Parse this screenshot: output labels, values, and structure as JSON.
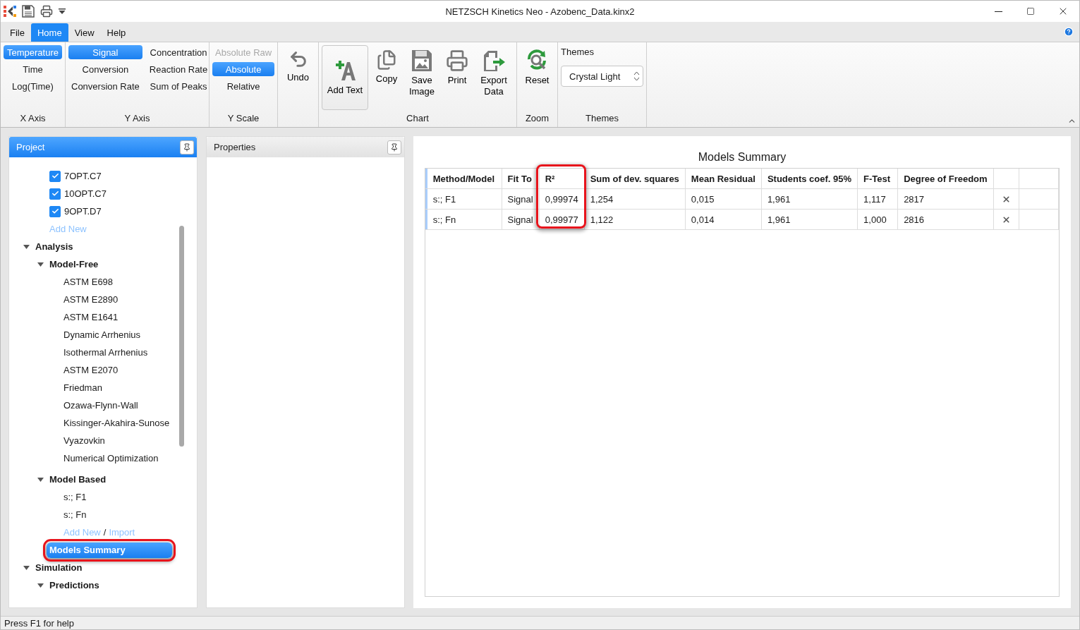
{
  "window": {
    "title": "NETZSCH Kinetics Neo - Azobenc_Data.kinx2"
  },
  "menu": [
    {
      "label": "File",
      "selected": false
    },
    {
      "label": "Home",
      "selected": true
    },
    {
      "label": "View",
      "selected": false
    },
    {
      "label": "Help",
      "selected": false
    }
  ],
  "ribbon": {
    "x_axis": {
      "label": "X Axis",
      "options": [
        {
          "label": "Temperature",
          "selected": true
        },
        {
          "label": "Time",
          "selected": false
        },
        {
          "label": "Log(Time)",
          "selected": false
        }
      ]
    },
    "y_axis": {
      "label": "Y Axis",
      "options": [
        {
          "label": "Signal",
          "selected": true
        },
        {
          "label": "Concentration",
          "selected": false
        },
        {
          "label": "Conversion",
          "selected": false
        },
        {
          "label": "Reaction Rate",
          "selected": false
        },
        {
          "label": "Conversion Rate",
          "selected": false
        },
        {
          "label": "Sum of Peaks",
          "selected": false
        }
      ]
    },
    "y_scale": {
      "label": "Y Scale",
      "options": [
        {
          "label": "Absolute Raw",
          "selected": false,
          "disabled": true
        },
        {
          "label": "Absolute",
          "selected": true,
          "disabled": false
        },
        {
          "label": "Relative",
          "selected": false,
          "disabled": false
        }
      ]
    },
    "undo": {
      "label": "Undo"
    },
    "chart": {
      "label": "Chart",
      "buttons": [
        {
          "label": "Add Text",
          "kind": "framed"
        },
        {
          "label": "Copy",
          "kind": "plain"
        },
        {
          "label": "Save Image",
          "kind": "plain"
        },
        {
          "label": "Print",
          "kind": "plain"
        },
        {
          "label": "Export Data",
          "kind": "plain"
        }
      ]
    },
    "zoom": {
      "label": "Zoom",
      "buttons": [
        {
          "label": "Reset"
        }
      ]
    },
    "themes": {
      "heading": "Themes",
      "value": "Crystal Light",
      "label": "Themes"
    }
  },
  "project": {
    "title": "Project",
    "tree": [
      {
        "children": [
          {
            "kind": "file",
            "label": "7OPT.C7",
            "checked": true
          },
          {
            "kind": "file",
            "label": "10OPT.C7",
            "checked": true
          },
          {
            "kind": "file",
            "label": "9OPT.D7",
            "checked": true
          },
          {
            "kind": "link",
            "label": "Add New"
          }
        ]
      },
      {
        "kind": "group",
        "label": "Analysis",
        "expanded": true,
        "children": [
          {
            "kind": "group",
            "label": "Model-Free",
            "expanded": true,
            "children": [
              {
                "kind": "item",
                "label": "ASTM E698",
                "selected": false
              },
              {
                "kind": "item",
                "label": "ASTM E2890",
                "selected": false
              },
              {
                "kind": "item",
                "label": "ASTM E1641",
                "selected": false
              },
              {
                "kind": "item",
                "label": "Dynamic Arrhenius",
                "selected": false
              },
              {
                "kind": "item",
                "label": "Isothermal Arrhenius",
                "selected": false
              },
              {
                "kind": "item",
                "label": "ASTM E2070",
                "selected": false
              },
              {
                "kind": "item",
                "label": "Friedman",
                "selected": false
              },
              {
                "kind": "item",
                "label": "Ozawa-Flynn-Wall",
                "selected": false
              },
              {
                "kind": "item",
                "label": "Kissinger-Akahira-Sunose",
                "selected": false
              },
              {
                "kind": "item",
                "label": "Vyazovkin",
                "selected": false
              },
              {
                "kind": "item",
                "label": "Numerical Optimization",
                "selected": false
              }
            ]
          },
          {
            "kind": "group",
            "label": "Model Based",
            "expanded": true,
            "children": [
              {
                "kind": "item",
                "label": "s:; F1",
                "selected": false
              },
              {
                "kind": "item",
                "label": "s:; Fn",
                "selected": false
              },
              {
                "kind": "links",
                "links": [
                  "Add New",
                  "Import"
                ],
                "separator": "/"
              }
            ]
          },
          {
            "kind": "item",
            "label": "Models Summary",
            "selected": true,
            "highlighted": true
          }
        ]
      },
      {
        "kind": "group",
        "label": "Simulation",
        "expanded": true,
        "children": [
          {
            "kind": "group",
            "label": "Predictions",
            "expanded": true
          }
        ]
      }
    ]
  },
  "properties": {
    "title": "Properties"
  },
  "summary": {
    "title": "Models Summary",
    "columns": [
      {
        "label": "Method/Model",
        "highlighted": false
      },
      {
        "label": "Fit To",
        "highlighted": false
      },
      {
        "label": "R²",
        "highlighted": true
      },
      {
        "label": "Sum of dev. squares",
        "highlighted": false
      },
      {
        "label": "Mean Residual",
        "highlighted": false
      },
      {
        "label": "Students coef. 95%",
        "highlighted": false
      },
      {
        "label": "F-Test",
        "highlighted": false
      },
      {
        "label": "Degree of Freedom",
        "highlighted": false
      }
    ],
    "rows": [
      {
        "cells": [
          "s:; F1",
          "Signal",
          "0,99974",
          "1,254",
          "0,015",
          "1,961",
          "1,117",
          "2817"
        ]
      },
      {
        "cells": [
          "s:; Fn",
          "Signal",
          "0,99977",
          "1,122",
          "0,014",
          "1,961",
          "1,000",
          "2816"
        ]
      }
    ]
  },
  "status_bar": {
    "text": "Press F1 for help"
  }
}
